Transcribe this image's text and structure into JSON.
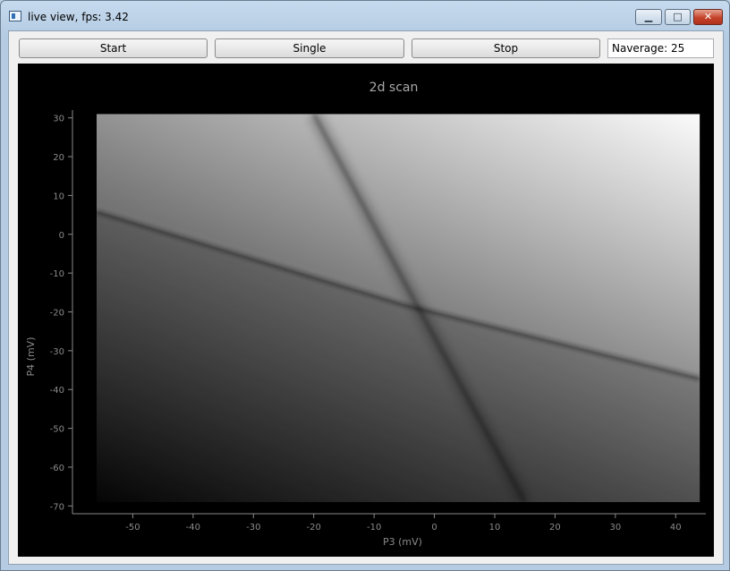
{
  "window": {
    "title": "live view, fps: 3.42",
    "minimize_glyph": "▁",
    "maximize_glyph": "□",
    "close_glyph": "✕"
  },
  "toolbar": {
    "start_label": "Start",
    "single_label": "Single",
    "stop_label": "Stop",
    "naverage_text": "Naverage: 25"
  },
  "chart_data": {
    "type": "heatmap",
    "title": "2d scan",
    "xlabel": "P3 (mV)",
    "ylabel": "P4 (mV)",
    "xlim": [
      -60,
      45
    ],
    "ylim": [
      -72,
      32
    ],
    "data_extent_x": [
      -56,
      44
    ],
    "data_extent_y": [
      -69,
      31
    ],
    "x_ticks": [
      -50,
      -40,
      -30,
      -20,
      -10,
      0,
      10,
      20,
      30,
      40
    ],
    "y_ticks": [
      30,
      20,
      10,
      0,
      -10,
      -20,
      -30,
      -40,
      -50,
      -60,
      -70
    ],
    "colormap": "grayscale",
    "transition_lines": [
      {
        "name": "",
        "points": [
          [
            -56,
            6
          ],
          [
            -5,
            -18
          ],
          [
            44,
            -37
          ]
        ]
      },
      {
        "name": "",
        "points": [
          [
            -20,
            31
          ],
          [
            -3,
            -18
          ],
          [
            15,
            -69
          ]
        ]
      }
    ],
    "grid": false,
    "colors": {
      "axis": "#8a8a8a",
      "title": "#a8a8a8",
      "background": "#000000"
    }
  }
}
